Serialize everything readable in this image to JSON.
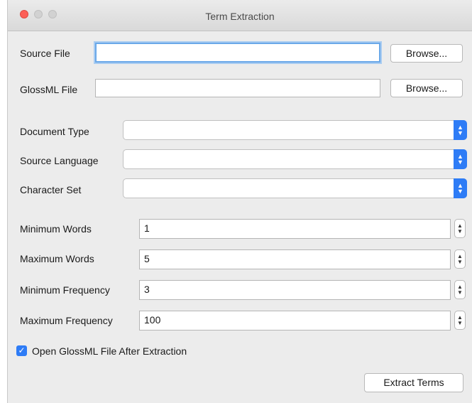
{
  "window": {
    "title": "Term Extraction"
  },
  "source_file": {
    "label": "Source File",
    "value": "",
    "browse_label": "Browse..."
  },
  "glossml_file": {
    "label": "GlossML File",
    "value": "",
    "browse_label": "Browse..."
  },
  "document_type": {
    "label": "Document Type",
    "value": ""
  },
  "source_language": {
    "label": "Source Language",
    "value": ""
  },
  "character_set": {
    "label": "Character Set",
    "value": ""
  },
  "min_words": {
    "label": "Minimum Words",
    "value": "1"
  },
  "max_words": {
    "label": "Maximum Words",
    "value": "5"
  },
  "min_frequency": {
    "label": "Minimum Frequency",
    "value": "3"
  },
  "max_frequency": {
    "label": "Maximum Frequency",
    "value": "100"
  },
  "open_after": {
    "label": "Open GlossML File After Extraction",
    "checked": true
  },
  "extract_button": {
    "label": "Extract Terms"
  },
  "icons": {
    "select_arrow": "chevron-updown-icon",
    "stepper": "stepper-icon",
    "check": "checkmark-icon"
  },
  "colors": {
    "accent": "#2e7cf6",
    "focus_ring": "#6aa8e8",
    "close": "#fc5f57"
  }
}
